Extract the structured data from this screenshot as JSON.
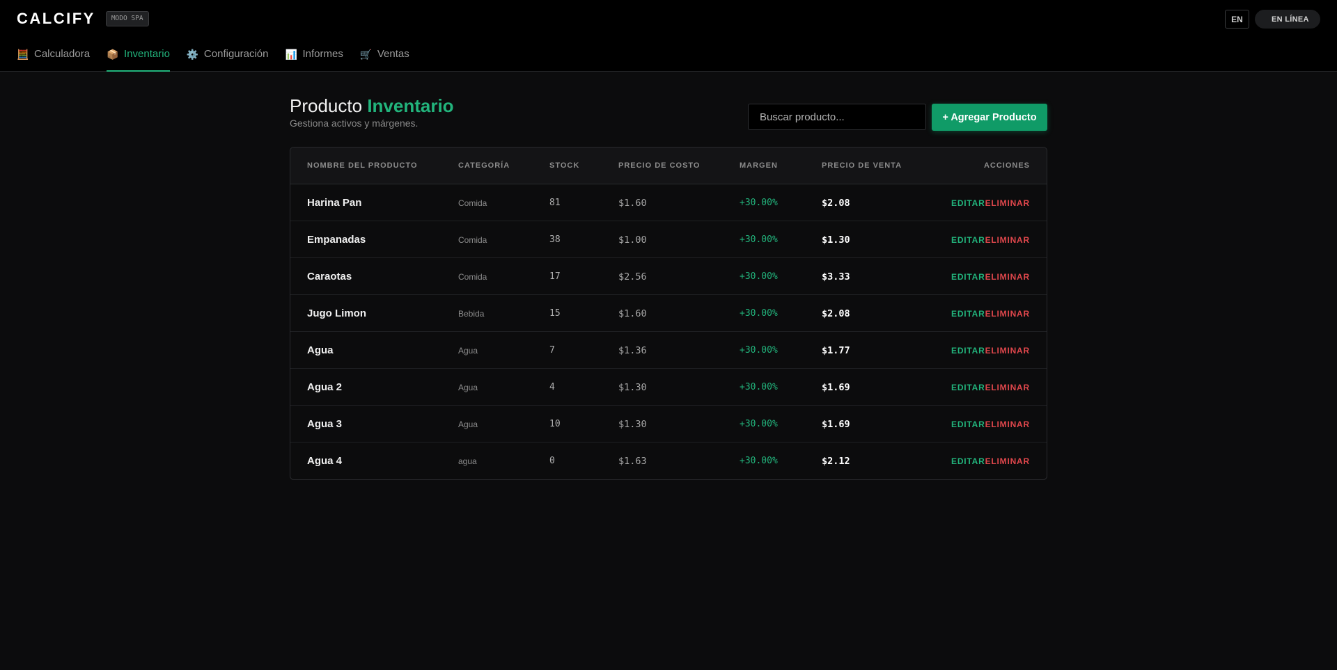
{
  "brand": {
    "name": "CALCIFY",
    "mode_badge": "MODO SPA"
  },
  "top_right": {
    "lang": "EN",
    "status": "EN LÍNEA"
  },
  "nav": [
    {
      "icon": "calculator-icon",
      "glyph": "🧮",
      "label": "Calculadora",
      "active": false
    },
    {
      "icon": "package-icon",
      "glyph": "📦",
      "label": "Inventario",
      "active": true
    },
    {
      "icon": "gear-icon",
      "glyph": "⚙️",
      "label": "Configuración",
      "active": false
    },
    {
      "icon": "bar-chart-icon",
      "glyph": "📊",
      "label": "Informes",
      "active": false
    },
    {
      "icon": "cart-icon",
      "glyph": "🛒",
      "label": "Ventas",
      "active": false
    }
  ],
  "page": {
    "title_main": "Producto",
    "title_accent": "Inventario",
    "subtitle": "Gestiona activos y márgenes.",
    "search_placeholder": "Buscar producto...",
    "add_button": "+ Agregar Producto"
  },
  "table": {
    "headers": {
      "name": "NOMBRE DEL PRODUCTO",
      "category": "CATEGORÍA",
      "stock": "STOCK",
      "cost": "PRECIO DE COSTO",
      "margin": "MARGEN",
      "price": "PRECIO DE VENTA",
      "actions": "ACCIONES"
    },
    "edit_label": "EDITAR",
    "delete_label": "ELIMINAR",
    "rows": [
      {
        "name": "Harina Pan",
        "category": "Comida",
        "stock": "81",
        "cost": "$1.60",
        "margin": "+30.00%",
        "price": "$2.08"
      },
      {
        "name": "Empanadas",
        "category": "Comida",
        "stock": "38",
        "cost": "$1.00",
        "margin": "+30.00%",
        "price": "$1.30"
      },
      {
        "name": "Caraotas",
        "category": "Comida",
        "stock": "17",
        "cost": "$2.56",
        "margin": "+30.00%",
        "price": "$3.33"
      },
      {
        "name": "Jugo Limon",
        "category": "Bebida",
        "stock": "15",
        "cost": "$1.60",
        "margin": "+30.00%",
        "price": "$2.08"
      },
      {
        "name": "Agua",
        "category": "Agua",
        "stock": "7",
        "cost": "$1.36",
        "margin": "+30.00%",
        "price": "$1.77"
      },
      {
        "name": "Agua 2",
        "category": "Agua",
        "stock": "4",
        "cost": "$1.30",
        "margin": "+30.00%",
        "price": "$1.69"
      },
      {
        "name": "Agua 3",
        "category": "Agua",
        "stock": "10",
        "cost": "$1.30",
        "margin": "+30.00%",
        "price": "$1.69"
      },
      {
        "name": "Agua 4",
        "category": "agua",
        "stock": "0",
        "cost": "$1.63",
        "margin": "+30.00%",
        "price": "$2.12"
      }
    ]
  },
  "colors": {
    "accent": "#22b47c",
    "danger": "#e0474c",
    "button": "#109b67"
  }
}
